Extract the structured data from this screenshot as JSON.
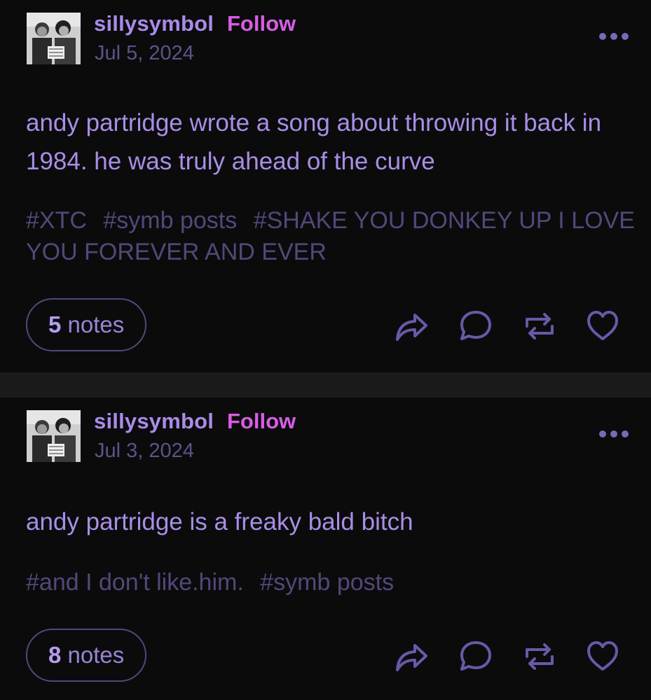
{
  "colors": {
    "username": "#a88ce8",
    "follow": "#d95ce6",
    "date": "#5f5188",
    "body": "#a98ee6",
    "tags": "#54477a",
    "icons": "#6a58a8",
    "background": "#0b0b0c",
    "separator": "#1a1a1b"
  },
  "posts": [
    {
      "username": "sillysymbol",
      "follow_label": "Follow",
      "date": "Jul 5, 2024",
      "body": "andy partridge wrote a song about throwing it back in 1984. he was truly ahead of the curve",
      "tags": [
        "#XTC",
        "#symb posts",
        "#SHAKE YOU DONKEY UP I LOVE YOU FOREVER AND EVER"
      ],
      "notes_count": "5",
      "notes_label": "notes",
      "icons": [
        "more-options-icon",
        "share-icon",
        "reply-icon",
        "reblog-icon",
        "like-icon"
      ]
    },
    {
      "username": "sillysymbol",
      "follow_label": "Follow",
      "date": "Jul 3, 2024",
      "body": "andy partridge is a freaky bald bitch",
      "tags": [
        "#and I don't like.him.",
        "#symb posts"
      ],
      "notes_count": "8",
      "notes_label": "notes",
      "icons": [
        "more-options-icon",
        "share-icon",
        "reply-icon",
        "reblog-icon",
        "like-icon"
      ]
    }
  ]
}
